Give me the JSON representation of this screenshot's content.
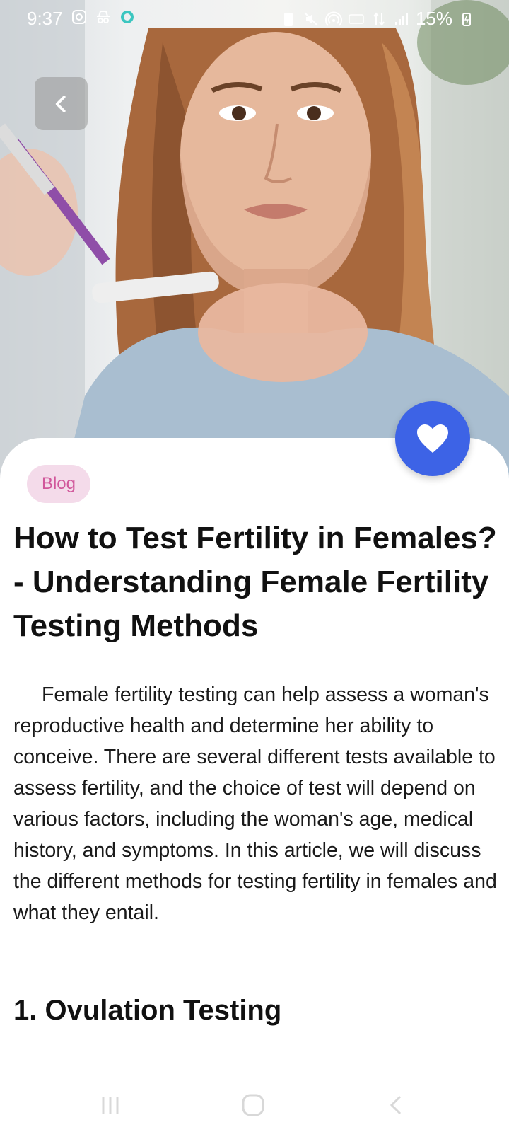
{
  "status_bar": {
    "time": "9:37",
    "battery": "15%",
    "left_icons": [
      "instagram-icon",
      "incognito-icon",
      "ring-app-icon"
    ],
    "right_icons": [
      "battery-saver-icon",
      "mute-icon",
      "hotspot-icon",
      "volte-icon",
      "lte-icon",
      "signal-icon",
      "charging-battery-icon"
    ]
  },
  "hero": {
    "image_label": "woman looking at a fertility test",
    "back_icon": "chevron-left-icon",
    "favorite_icon": "heart-icon"
  },
  "article": {
    "tag": "Blog",
    "title": "How to Test Fertility in Females? - Understanding Female Fertility Testing Methods",
    "body": "Female fertility testing can help assess a woman's reproductive health and determine her ability to conceive. There are several different tests available to assess fertility, and the choice of test will depend on various factors, including the woman's age, medical history, and symptoms. In this article, we will discuss the different methods for testing fertility in females and what they entail.",
    "section_heading": "1. Ovulation Testing"
  },
  "nav_bar": {
    "recents_icon": "recents-icon",
    "home_icon": "home-icon",
    "back_icon": "back-icon"
  },
  "colors": {
    "accent": "#3d63e6",
    "tag_bg": "#f4dbea",
    "tag_text": "#d1579b"
  }
}
